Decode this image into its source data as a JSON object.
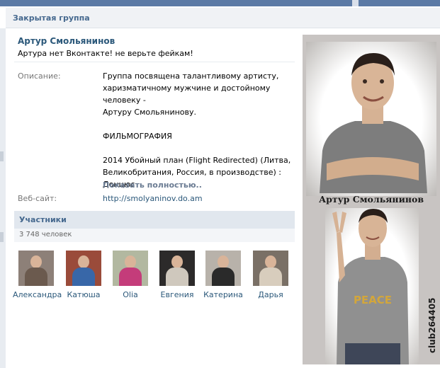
{
  "titlebar": {
    "title": "Закрытая группа"
  },
  "group": {
    "name": "Артур Смольянинов",
    "status": "Артура нет Вконтакте! не верьте фейкам!"
  },
  "info": {
    "description_label": "Описание:",
    "description_lines": [
      "Группа посвящена талантливому артисту,",
      "харизматичному мужчине и достойному человеку -",
      "Артуру Смольянинову.",
      "",
      "ФИЛЬМОГРАФИЯ",
      "",
      "2014 Убойный план (Flight Redirected) (Литва,",
      "Великобритания, Россия, в производстве) :",
      "Донцюс"
    ],
    "show_more": "Показать полностью..",
    "website_label": "Веб-сайт:",
    "website": "http://smolyaninov.do.am"
  },
  "members": {
    "title": "Участники",
    "count": "3 748 человек",
    "items": [
      {
        "name": "Александра",
        "color": "#6b5a4e",
        "bg": "#8d8078"
      },
      {
        "name": "Катюша",
        "color": "#3867a8",
        "bg": "#9a4b3a"
      },
      {
        "name": "Olia",
        "color": "#c43c7a",
        "bg": "#b2b8a0"
      },
      {
        "name": "Евгения",
        "color": "#cfc8bd",
        "bg": "#2c2a2a"
      },
      {
        "name": "Катерина",
        "color": "#2a2a2a",
        "bg": "#b8b2aa"
      },
      {
        "name": "Дарья",
        "color": "#d8cdbd",
        "bg": "#7a7066"
      }
    ]
  },
  "poster": {
    "caption": "Артур Смольянинов",
    "watermark": "club264405",
    "shirt_text": "PEACE"
  }
}
